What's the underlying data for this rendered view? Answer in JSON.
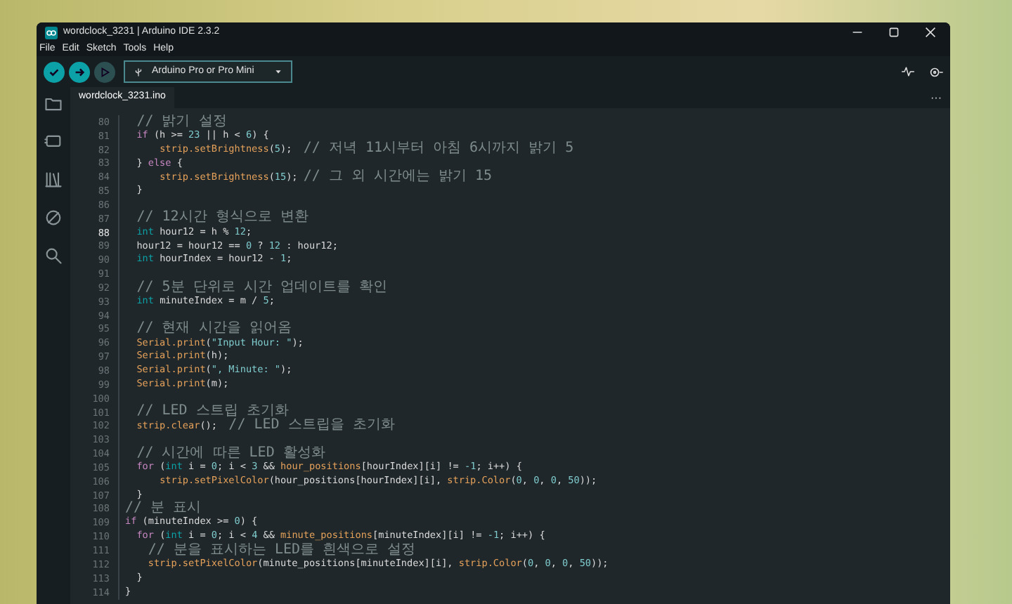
{
  "window": {
    "title": "wordclock_3231 | Arduino IDE 2.3.2"
  },
  "menu": [
    "File",
    "Edit",
    "Sketch",
    "Tools",
    "Help"
  ],
  "toolbar": {
    "board": "Arduino Pro or Pro Mini",
    "debug_disabled": true
  },
  "tabs": [
    {
      "label": "wordclock_3231.ino",
      "selected": true
    }
  ],
  "more": "···",
  "code": [
    {
      "number": "80",
      "current": false,
      "tokens": [
        {
          "kind": "comment",
          "text": "  // 밝기 설정"
        }
      ]
    },
    {
      "number": "81",
      "current": false,
      "tokens": [
        {
          "kind": "keyword",
          "text": "  if"
        },
        {
          "kind": "plain",
          "text": " (h >= "
        },
        {
          "kind": "number",
          "text": "23"
        },
        {
          "kind": "plain",
          "text": " || h < "
        },
        {
          "kind": "number",
          "text": "6"
        },
        {
          "kind": "plain",
          "text": ") {"
        }
      ]
    },
    {
      "number": "82",
      "current": false,
      "tokens": [
        {
          "kind": "function",
          "text": "      strip.setBrightness"
        },
        {
          "kind": "plain",
          "text": "("
        },
        {
          "kind": "number",
          "text": "5"
        },
        {
          "kind": "plain",
          "text": ");  "
        },
        {
          "kind": "comment",
          "text": "// 저녁 11시부터 아침 6시까지 밝기 5"
        }
      ]
    },
    {
      "number": "83",
      "current": false,
      "tokens": [
        {
          "kind": "plain",
          "text": "  } "
        },
        {
          "kind": "keyword",
          "text": "else"
        },
        {
          "kind": "plain",
          "text": " {"
        }
      ]
    },
    {
      "number": "84",
      "current": false,
      "tokens": [
        {
          "kind": "function",
          "text": "      strip.setBrightness"
        },
        {
          "kind": "plain",
          "text": "("
        },
        {
          "kind": "number",
          "text": "15"
        },
        {
          "kind": "plain",
          "text": "); "
        },
        {
          "kind": "comment",
          "text": "// 그 외 시간에는 밝기 15"
        }
      ]
    },
    {
      "number": "85",
      "current": false,
      "tokens": [
        {
          "kind": "plain",
          "text": "  }"
        }
      ]
    },
    {
      "number": "86",
      "current": false
    },
    {
      "number": "87",
      "current": false,
      "tokens": [
        {
          "kind": "comment",
          "text": "  // 12시간 형식으로 변환"
        }
      ]
    },
    {
      "number": "88",
      "current": true,
      "tokens": [
        {
          "kind": "type",
          "text": "  int"
        },
        {
          "kind": "plain",
          "text": " hour12 = h % "
        },
        {
          "kind": "number",
          "text": "12"
        },
        {
          "kind": "plain",
          "text": ";"
        }
      ]
    },
    {
      "number": "89",
      "current": false,
      "tokens": [
        {
          "kind": "plain",
          "text": "  hour12 = hour12 == "
        },
        {
          "kind": "number",
          "text": "0"
        },
        {
          "kind": "plain",
          "text": " ? "
        },
        {
          "kind": "number",
          "text": "12"
        },
        {
          "kind": "plain",
          "text": " : hour12;"
        }
      ]
    },
    {
      "number": "90",
      "current": false,
      "tokens": [
        {
          "kind": "type",
          "text": "  int"
        },
        {
          "kind": "plain",
          "text": " hourIndex = hour12 - "
        },
        {
          "kind": "number",
          "text": "1"
        },
        {
          "kind": "plain",
          "text": ";"
        }
      ]
    },
    {
      "number": "91",
      "current": false
    },
    {
      "number": "92",
      "current": false,
      "tokens": [
        {
          "kind": "comment",
          "text": "  // 5분 단위로 시간 업데이트를 확인"
        }
      ]
    },
    {
      "number": "93",
      "current": false,
      "tokens": [
        {
          "kind": "type",
          "text": "  int"
        },
        {
          "kind": "plain",
          "text": " minuteIndex = m / "
        },
        {
          "kind": "number",
          "text": "5"
        },
        {
          "kind": "plain",
          "text": ";"
        }
      ]
    },
    {
      "number": "94",
      "current": false
    },
    {
      "number": "95",
      "current": false,
      "tokens": [
        {
          "kind": "comment",
          "text": "  // 현재 시간을 읽어옴"
        }
      ]
    },
    {
      "number": "96",
      "current": false,
      "tokens": [
        {
          "kind": "function",
          "text": "  Serial.print"
        },
        {
          "kind": "plain",
          "text": "("
        },
        {
          "kind": "string",
          "text": "\"Input Hour: \""
        },
        {
          "kind": "plain",
          "text": ");"
        }
      ]
    },
    {
      "number": "97",
      "current": false,
      "tokens": [
        {
          "kind": "function",
          "text": "  Serial.print"
        },
        {
          "kind": "plain",
          "text": "(h);"
        }
      ]
    },
    {
      "number": "98",
      "current": false,
      "tokens": [
        {
          "kind": "function",
          "text": "  Serial.print"
        },
        {
          "kind": "plain",
          "text": "("
        },
        {
          "kind": "string",
          "text": "\", Minute: \""
        },
        {
          "kind": "plain",
          "text": ");"
        }
      ]
    },
    {
      "number": "99",
      "current": false,
      "tokens": [
        {
          "kind": "function",
          "text": "  Serial.print"
        },
        {
          "kind": "plain",
          "text": "(m);"
        }
      ]
    },
    {
      "number": "100",
      "current": false
    },
    {
      "number": "101",
      "current": false,
      "tokens": [
        {
          "kind": "comment",
          "text": "  // LED 스트립 초기화"
        }
      ]
    },
    {
      "number": "102",
      "current": false,
      "tokens": [
        {
          "kind": "function",
          "text": "  strip.clear"
        },
        {
          "kind": "plain",
          "text": "();  "
        },
        {
          "kind": "comment",
          "text": "// LED 스트립을 초기화"
        }
      ]
    },
    {
      "number": "103",
      "current": false
    },
    {
      "number": "104",
      "current": false,
      "tokens": [
        {
          "kind": "comment",
          "text": "  // 시간에 따른 LED 활성화"
        }
      ]
    },
    {
      "number": "105",
      "current": false,
      "tokens": [
        {
          "kind": "keyword",
          "text": "  for"
        },
        {
          "kind": "plain",
          "text": " ("
        },
        {
          "kind": "type",
          "text": "int"
        },
        {
          "kind": "plain",
          "text": " i = "
        },
        {
          "kind": "number",
          "text": "0"
        },
        {
          "kind": "plain",
          "text": "; i < "
        },
        {
          "kind": "number",
          "text": "3"
        },
        {
          "kind": "plain",
          "text": " && "
        },
        {
          "kind": "function",
          "text": "hour_positions"
        },
        {
          "kind": "plain",
          "text": "[hourIndex][i] != "
        },
        {
          "kind": "number",
          "text": "-1"
        },
        {
          "kind": "plain",
          "text": "; i++) {"
        }
      ]
    },
    {
      "number": "106",
      "current": false,
      "tokens": [
        {
          "kind": "function",
          "text": "      strip.setPixelColor"
        },
        {
          "kind": "plain",
          "text": "(hour_positions[hourIndex][i], "
        },
        {
          "kind": "function",
          "text": "strip.Color"
        },
        {
          "kind": "plain",
          "text": "("
        },
        {
          "kind": "number",
          "text": "0"
        },
        {
          "kind": "plain",
          "text": ", "
        },
        {
          "kind": "number",
          "text": "0"
        },
        {
          "kind": "plain",
          "text": ", "
        },
        {
          "kind": "number",
          "text": "0"
        },
        {
          "kind": "plain",
          "text": ", "
        },
        {
          "kind": "number",
          "text": "50"
        },
        {
          "kind": "plain",
          "text": "));"
        }
      ]
    },
    {
      "number": "107",
      "current": false,
      "tokens": [
        {
          "kind": "plain",
          "text": "  }"
        }
      ]
    },
    {
      "number": "108",
      "current": false,
      "tokens": [
        {
          "kind": "comment",
          "text": "// 분 표시"
        }
      ]
    },
    {
      "number": "109",
      "current": false,
      "tokens": [
        {
          "kind": "keyword",
          "text": "if"
        },
        {
          "kind": "plain",
          "text": " (minuteIndex >= "
        },
        {
          "kind": "number",
          "text": "0"
        },
        {
          "kind": "plain",
          "text": ") {"
        }
      ]
    },
    {
      "number": "110",
      "current": false,
      "tokens": [
        {
          "kind": "keyword",
          "text": "  for"
        },
        {
          "kind": "plain",
          "text": " ("
        },
        {
          "kind": "type",
          "text": "int"
        },
        {
          "kind": "plain",
          "text": " i = "
        },
        {
          "kind": "number",
          "text": "0"
        },
        {
          "kind": "plain",
          "text": "; i < "
        },
        {
          "kind": "number",
          "text": "4"
        },
        {
          "kind": "plain",
          "text": " && "
        },
        {
          "kind": "function",
          "text": "minute_positions"
        },
        {
          "kind": "plain",
          "text": "[minuteIndex][i] != "
        },
        {
          "kind": "number",
          "text": "-1"
        },
        {
          "kind": "plain",
          "text": "; i++) {"
        }
      ]
    },
    {
      "number": "111",
      "current": false,
      "tokens": [
        {
          "kind": "comment",
          "text": "    // 분을 표시하는 LED를 흰색으로 설정"
        }
      ]
    },
    {
      "number": "112",
      "current": false,
      "tokens": [
        {
          "kind": "function",
          "text": "    strip.setPixelColor"
        },
        {
          "kind": "plain",
          "text": "(minute_positions[minuteIndex][i], "
        },
        {
          "kind": "function",
          "text": "strip.Color"
        },
        {
          "kind": "plain",
          "text": "("
        },
        {
          "kind": "number",
          "text": "0"
        },
        {
          "kind": "plain",
          "text": ", "
        },
        {
          "kind": "number",
          "text": "0"
        },
        {
          "kind": "plain",
          "text": ", "
        },
        {
          "kind": "number",
          "text": "0"
        },
        {
          "kind": "plain",
          "text": ", "
        },
        {
          "kind": "number",
          "text": "50"
        },
        {
          "kind": "plain",
          "text": "));"
        }
      ]
    },
    {
      "number": "113",
      "current": false,
      "tokens": [
        {
          "kind": "plain",
          "text": "  }"
        }
      ]
    },
    {
      "number": "114",
      "current": false,
      "tokens": [
        {
          "kind": "plain",
          "text": "}"
        }
      ]
    }
  ]
}
